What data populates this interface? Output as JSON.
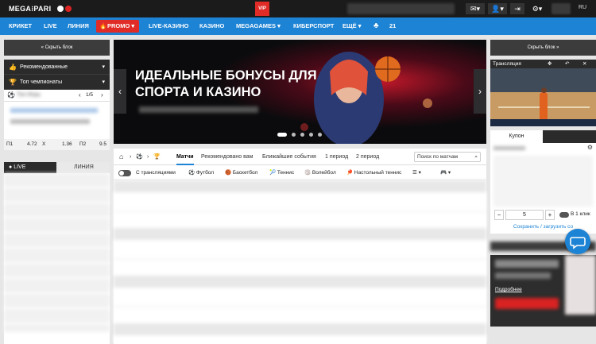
{
  "topbar": {
    "logo": "MEGA⁝PARI",
    "vip_label": "VIP",
    "lang": "RU"
  },
  "nav": {
    "items": [
      "КРИКЕТ",
      "LIVE",
      "ЛИНИЯ"
    ],
    "promo": "PROMO",
    "items2": [
      "LIVE-КАЗИНО",
      "КАЗИНО",
      "MEGAGAMES",
      "КИБЕРСПОРТ",
      "ЕЩЁ"
    ],
    "count": "21"
  },
  "left": {
    "collapse_label": "Скрыть блок",
    "rows": [
      {
        "icon": "thumbs-up-icon",
        "label": "Рекомендованные"
      },
      {
        "icon": "trophy-icon",
        "label": "Топ чемпионаты"
      }
    ],
    "top_games_label": "Топ Игры",
    "pager": "1/5",
    "odds": [
      {
        "label": "П1",
        "value": "4.72"
      },
      {
        "label": "X",
        "value": "1.36"
      },
      {
        "label": "П2",
        "value": "9.5"
      }
    ],
    "live_tab": "LIVE",
    "line_tab": "ЛИНИЯ"
  },
  "banner": {
    "title_line1": "ИДЕАЛЬНЫЕ БОНУСЫ ДЛЯ",
    "title_line2": "СПОРТА И КАЗИНО",
    "slides": 5,
    "active_slide": 1
  },
  "matches": {
    "tabs": [
      "Матчи",
      "Рекомендовано вам",
      "Ближайшие события",
      "1 период",
      "2 период"
    ],
    "search_placeholder": "Поиск по матчам",
    "stream_toggle": "С трансляциями",
    "sports": [
      "Футбол",
      "Баскетбол",
      "Теннис",
      "Волейбол",
      "Настольный теннис"
    ]
  },
  "right": {
    "collapse_label": "Скрыть блок",
    "stream_label": "Трансляция",
    "coupon_tab": "Купон",
    "stake_value": "5",
    "one_click": "В 1 клик",
    "save_load": "Сохранить / загрузить со",
    "more_link": "Подробнее"
  },
  "colors": {
    "nav_blue": "#1d83d4",
    "promo_red": "#e02b27",
    "dark": "#1b1b1b",
    "chat_blue": "#1d83d4"
  }
}
